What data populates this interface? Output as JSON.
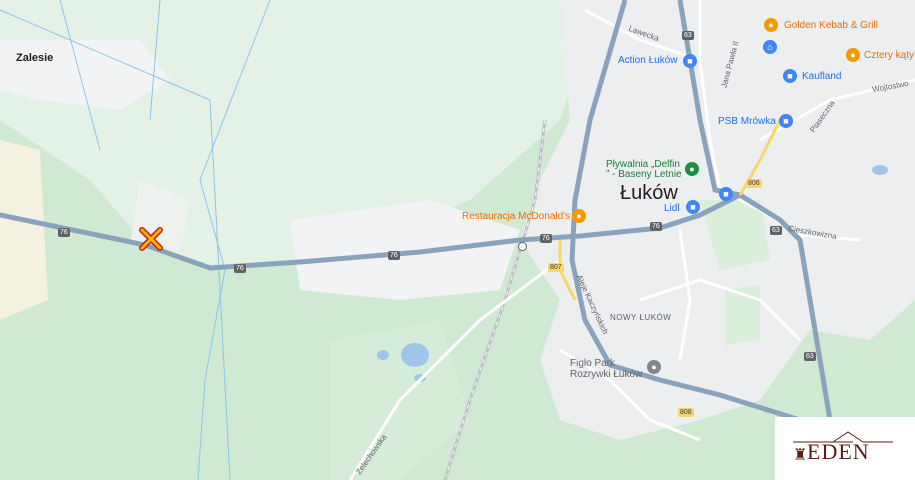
{
  "map": {
    "town": "Łuków",
    "village": "Zalesie",
    "district": "NOWY ŁUKÓW",
    "streets": [
      "Lawecka",
      "Jana Pawła II",
      "Wojtostwo",
      "Piaseczna",
      "Cieszkowizna",
      "Aleje Kaczyńskich",
      "Żelechowska"
    ],
    "roads": [
      {
        "number": "76",
        "color": "#8aa3bd"
      },
      {
        "number": "63",
        "color": "#8aa3bd"
      },
      {
        "number": "806",
        "color": "#f9d66b"
      },
      {
        "number": "807",
        "color": "#f9d66b"
      },
      {
        "number": "808",
        "color": "#f9d66b"
      }
    ],
    "pois": [
      {
        "name": "Golden Kebab & Grill",
        "icon": "restaurant-icon",
        "color": "#e8710a"
      },
      {
        "name": "Action Łuków",
        "icon": "shopping-bag-icon",
        "color": "#1a73e8"
      },
      {
        "name": "Kaufland",
        "icon": "shopping-cart-icon",
        "color": "#1a73e8"
      },
      {
        "name": "Cztery kąty",
        "icon": "restaurant-icon",
        "color": "#e8710a"
      },
      {
        "name": "PSB Mrówka",
        "icon": "shopping-bag-icon",
        "color": "#1a73e8"
      },
      {
        "name": "Pływalnia „Delfin ” - Baseny Letnie",
        "icon": "pool-icon",
        "color": "#188038"
      },
      {
        "name": "Lidl",
        "icon": "shopping-cart-icon",
        "color": "#1a73e8"
      },
      {
        "name": "Restauracja McDonald's",
        "icon": "restaurant-icon",
        "color": "#e8710a"
      },
      {
        "name": "Figlo Park Rozrywki Łuków",
        "icon": "park-icon",
        "color": "#5f6368"
      }
    ],
    "location_marker": {
      "icon": "cross-marker-icon",
      "color": "#f4b400"
    }
  },
  "logo": {
    "text": "EDEN",
    "icon": "crown-icon",
    "color": "#5a1e16"
  }
}
